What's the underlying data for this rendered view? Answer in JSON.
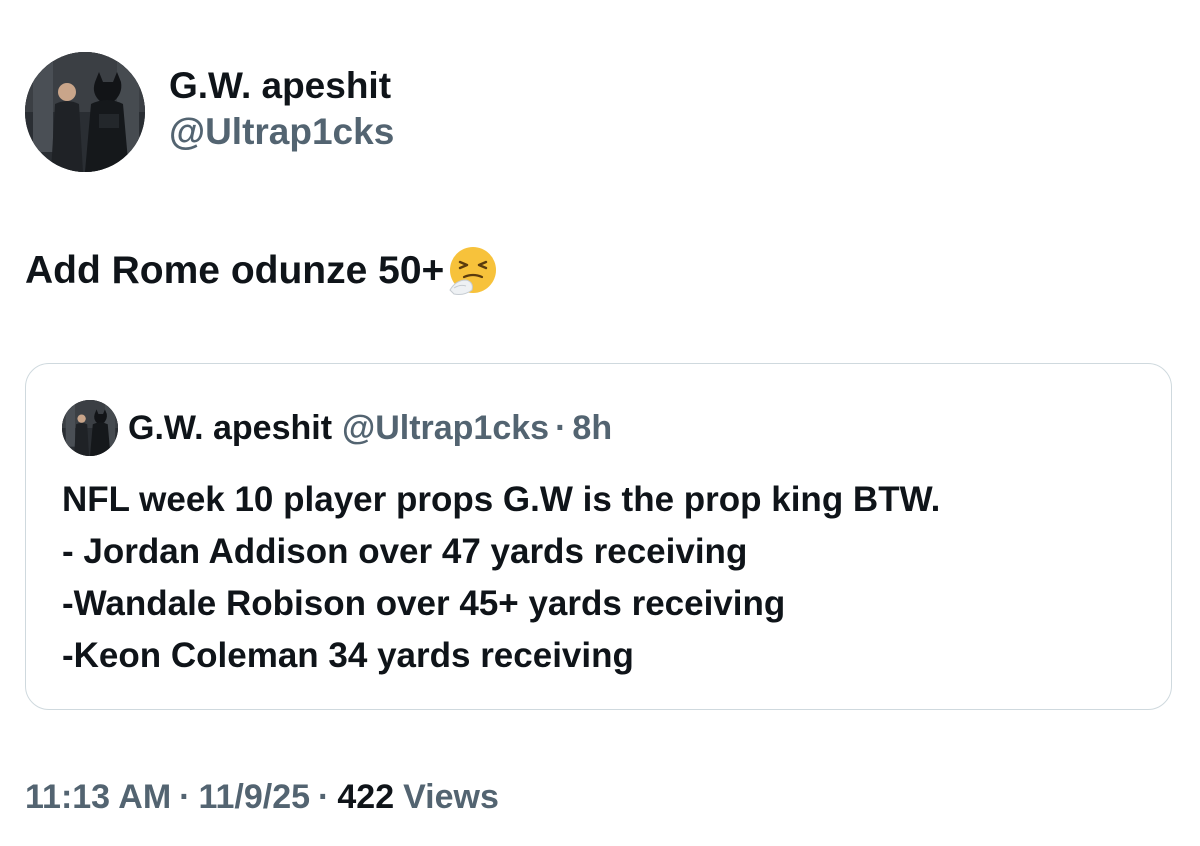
{
  "author": {
    "display_name": "G.W. apeshit",
    "handle": "@Ultrap1cks"
  },
  "tweet": {
    "text": "Add Rome odunze 50+",
    "emoji": "sneezing-face-emoji"
  },
  "quoted_tweet": {
    "display_name": "G.W. apeshit",
    "handle": "@Ultrap1cks",
    "separator": "·",
    "time": "8h",
    "lines": [
      "NFL week 10 player props G.W is the prop king BTW.",
      "- Jordan Addison over 47 yards receiving",
      "-Wandale Robison over 45+ yards receiving",
      "-Keon Coleman 34 yards receiving"
    ]
  },
  "meta": {
    "time": "11:13 AM",
    "separator": "·",
    "date": "11/9/25",
    "views_count": "422",
    "views_label": "Views"
  },
  "colors": {
    "primary_text": "#0f1419",
    "secondary_text": "#536471",
    "border": "#cfd9de",
    "background": "#ffffff"
  }
}
